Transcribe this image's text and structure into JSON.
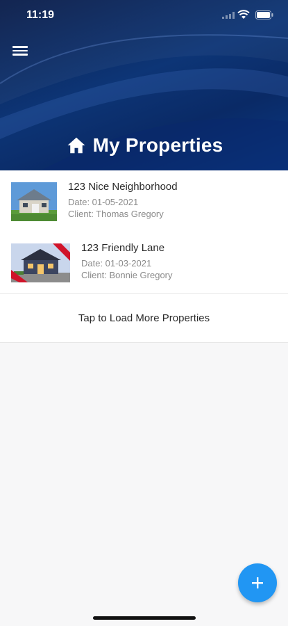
{
  "status_bar": {
    "time": "11:19"
  },
  "header": {
    "title": "My Properties"
  },
  "properties": [
    {
      "name": "123 Nice Neighborhood",
      "date": "Date: 01-05-2021",
      "client": "Client: Thomas Gregory"
    },
    {
      "name": "123 Friendly Lane",
      "date": "Date: 01-03-2021",
      "client": "Client: Bonnie Gregory"
    }
  ],
  "load_more_label": "Tap to Load More Properties",
  "colors": {
    "header_blue": "#0d3576",
    "fab_blue": "#2196f3",
    "ribbon_red": "#d0142a"
  },
  "icons": [
    "menu-icon",
    "home-icon",
    "add-icon",
    "wifi-icon",
    "battery-icon",
    "signal-icon"
  ]
}
